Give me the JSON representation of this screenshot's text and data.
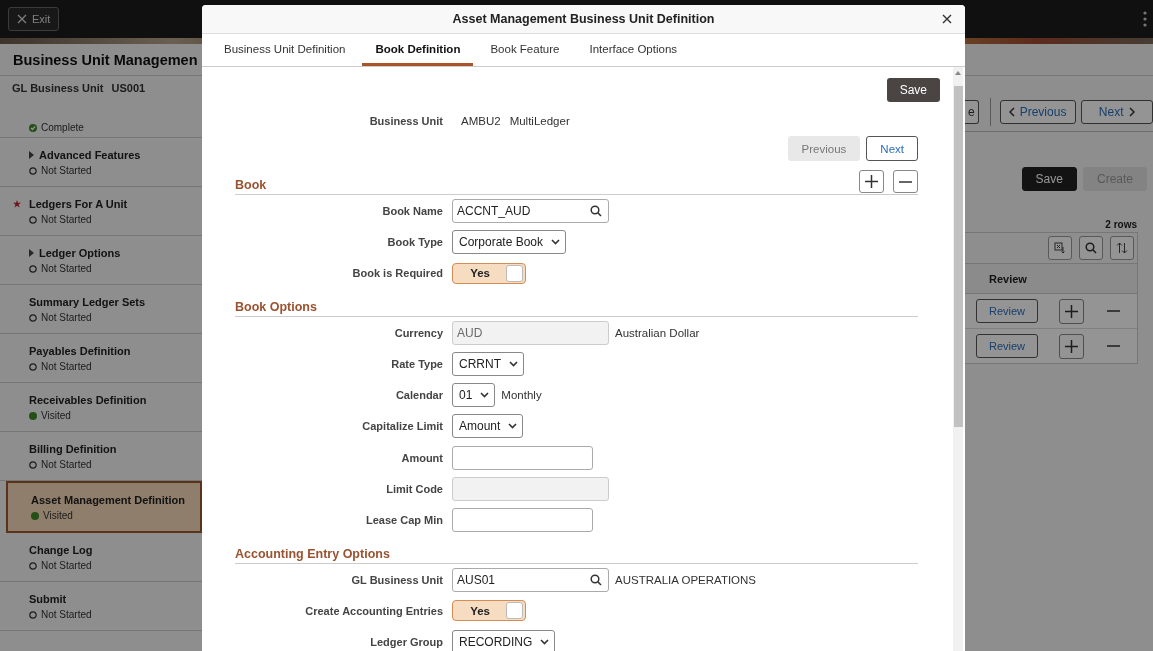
{
  "background_page": {
    "exit_button": "Exit",
    "title": "Business Unit Managemen",
    "gl_business_unit": {
      "label": "GL Business Unit",
      "value": "US001"
    },
    "steps": [
      {
        "status": "Complete",
        "kind": "complete",
        "expandable": false,
        "required": false,
        "selected": false
      },
      {
        "title": "Advanced Features",
        "status": "Not Started",
        "kind": "not_started",
        "expandable": true,
        "required": false,
        "selected": false
      },
      {
        "title": "Ledgers For A Unit",
        "status": "Not Started",
        "kind": "not_started",
        "expandable": false,
        "required": true,
        "selected": false
      },
      {
        "title": "Ledger Options",
        "status": "Not Started",
        "kind": "not_started",
        "expandable": true,
        "required": false,
        "selected": false
      },
      {
        "title": "Summary Ledger Sets",
        "status": "Not Started",
        "kind": "not_started",
        "expandable": false,
        "required": false,
        "selected": false
      },
      {
        "title": "Payables Definition",
        "status": "Not Started",
        "kind": "not_started",
        "expandable": false,
        "required": false,
        "selected": false
      },
      {
        "title": "Receivables Definition",
        "status": "Visited",
        "kind": "visited",
        "expandable": false,
        "required": false,
        "selected": false
      },
      {
        "title": "Billing Definition",
        "status": "Not Started",
        "kind": "not_started",
        "expandable": false,
        "required": false,
        "selected": false
      },
      {
        "title": "Asset Management Definition",
        "status": "Visited",
        "kind": "visited",
        "expandable": false,
        "required": false,
        "selected": true
      },
      {
        "title": "Change Log",
        "status": "Not Started",
        "kind": "not_started",
        "expandable": false,
        "required": false,
        "selected": false
      },
      {
        "title": "Submit",
        "status": "Not Started",
        "kind": "not_started",
        "expandable": false,
        "required": false,
        "selected": false
      }
    ],
    "nav_buttons": [
      {
        "label": "e",
        "kind": "plain"
      },
      {
        "label": "Previous",
        "kind": "previous"
      },
      {
        "label": "Next",
        "kind": "next"
      }
    ],
    "actions": [
      {
        "label": "Save",
        "kind": "primary",
        "disabled": false
      },
      {
        "label": "Create",
        "kind": "secondary",
        "disabled": true
      }
    ],
    "grid": {
      "row_count": "2 rows",
      "columns": [
        "Review"
      ],
      "rows": [
        {
          "review_button": "Review"
        },
        {
          "review_button": "Review"
        }
      ]
    }
  },
  "modal": {
    "title": "Asset Management Business Unit Definition",
    "tabs": [
      {
        "label": "Business Unit Definition",
        "selected": false
      },
      {
        "label": "Book Definition",
        "selected": true
      },
      {
        "label": "Book Feature",
        "selected": false
      },
      {
        "label": "Interface Options",
        "selected": false
      }
    ],
    "save_button": "Save",
    "business_unit": {
      "label": "Business Unit",
      "value": "AMBU2",
      "description": "MultiLedger"
    },
    "pager": [
      {
        "label": "Previous",
        "disabled": true
      },
      {
        "label": "Next",
        "disabled": false
      }
    ],
    "sections": [
      {
        "title": "Book",
        "row_buttons": true,
        "fields": [
          {
            "kind": "lookup",
            "label": "Book Name",
            "value": "ACCNT_AUD"
          },
          {
            "kind": "select",
            "label": "Book Type",
            "value": "Corporate Book"
          },
          {
            "kind": "toggle",
            "label": "Book is Required",
            "value": "Yes",
            "on": true
          }
        ]
      },
      {
        "title": "Book Options",
        "row_buttons": false,
        "fields": [
          {
            "kind": "readonly",
            "label": "Currency",
            "value": "AUD",
            "description": "Australian Dollar"
          },
          {
            "kind": "select",
            "label": "Rate Type",
            "value": "CRRNT"
          },
          {
            "kind": "select",
            "label": "Calendar",
            "value": "01",
            "description": "Monthly"
          },
          {
            "kind": "select",
            "label": "Capitalize Limit",
            "value": "Amount"
          },
          {
            "kind": "text",
            "label": "Amount"
          },
          {
            "kind": "disabled",
            "label": "Limit Code"
          },
          {
            "kind": "text",
            "label": "Lease Cap Min"
          }
        ]
      },
      {
        "title": "Accounting Entry Options",
        "row_buttons": false,
        "fields": [
          {
            "kind": "lookup",
            "label": "GL Business Unit",
            "value": "AUS01",
            "description": "AUSTRALIA OPERATIONS"
          },
          {
            "kind": "toggle",
            "label": "Create Accounting Entries",
            "value": "Yes",
            "on": true
          },
          {
            "kind": "select",
            "label": "Ledger Group",
            "value": "RECORDING"
          }
        ]
      }
    ]
  }
}
